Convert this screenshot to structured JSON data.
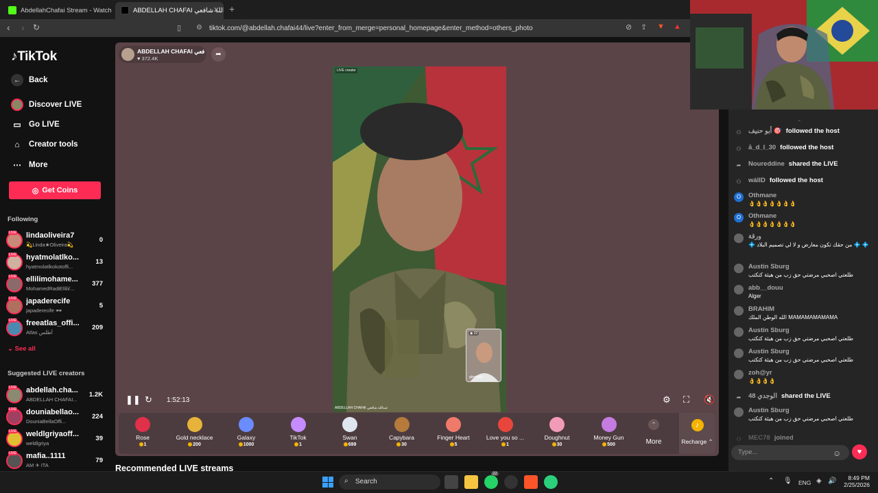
{
  "browser": {
    "tabs": [
      {
        "title": "AbdellahChafai Stream - Watch Live o"
      },
      {
        "title": "ABDELLAH CHAFAI عبدالله شافعي"
      }
    ],
    "url": "tiktok.com/@abdellah.chafai44/live?enter_from_merge=personal_homepage&enter_method=others_photo"
  },
  "sidebar": {
    "logo": "TikTok",
    "nav": [
      {
        "label": "Back",
        "icon": "arrow-left-icon"
      },
      {
        "label": "Discover LIVE",
        "icon": "avatar-icon"
      },
      {
        "label": "Go LIVE",
        "icon": "camera-icon"
      },
      {
        "label": "Creator tools",
        "icon": "home-icon"
      },
      {
        "label": "More",
        "icon": "ellipsis-icon"
      }
    ],
    "get_coins": "Get Coins",
    "following_title": "Following",
    "following": [
      {
        "name": "lindaoliveira7",
        "sub": "💫Linda★Oliveira💫",
        "count": "0"
      },
      {
        "name": "hyatmolatlko...",
        "sub": "hyatmolatlkokotoffi...",
        "count": "13"
      },
      {
        "name": "ellilimohame...",
        "sub": "MohamedRadiEllili/...",
        "count": "377"
      },
      {
        "name": "japaderecife",
        "sub": "japaderecife 🕶",
        "count": "5"
      },
      {
        "name": "freeatlas_offi...",
        "sub": "Atlas أطلس",
        "count": "209"
      }
    ],
    "see_all": "See all",
    "suggested_title": "Suggested LIVE creators",
    "suggested": [
      {
        "name": "abdellah.cha...",
        "sub": "ABDELLAH CHAFAI...",
        "count": "1.2K"
      },
      {
        "name": "douniabellao...",
        "sub": "DouniaBellaOffi...",
        "count": "224"
      },
      {
        "name": "weldlgriyaoff...",
        "sub": "weldlgriya",
        "count": "39"
      },
      {
        "name": "mafia..1111",
        "sub": "AM ✈ ITA",
        "count": "79"
      }
    ]
  },
  "stream": {
    "host_name": "ABDELLAH CHAFAI عبدالله شافعي",
    "likes": "372.4K",
    "creator_badge": "LIVE creator",
    "caption": "ABDELLAH CHAFAI عبدالله شافعي",
    "pip_label": "gbmbaal...",
    "pip_viewers": "22",
    "elapsed": "1:52:13",
    "recommended_title": "Recommended LIVE streams"
  },
  "gifts": [
    {
      "name": "Rose",
      "price": "1",
      "color": "#e0304a"
    },
    {
      "name": "Gold necklace",
      "price": "200",
      "color": "#e8b33a"
    },
    {
      "name": "Galaxy",
      "price": "1000",
      "color": "#6a8cff"
    },
    {
      "name": "TikTok",
      "price": "1",
      "color": "#c58cff"
    },
    {
      "name": "Swan",
      "price": "699",
      "color": "#dfe6f0"
    },
    {
      "name": "Capybara",
      "price": "30",
      "color": "#b57a3c"
    },
    {
      "name": "Finger Heart",
      "price": "5",
      "color": "#f07a6a"
    },
    {
      "name": "Love you so ...",
      "price": "1",
      "color": "#e8463c"
    },
    {
      "name": "Doughnut",
      "price": "30",
      "color": "#f29bb8"
    },
    {
      "name": "Money Gun",
      "price": "500",
      "color": "#c47ce0"
    }
  ],
  "gift_more": "More",
  "recharge": "Recharge",
  "chat": {
    "messages": [
      {
        "user": "أبو حنيف 🎯",
        "action": "followed the host",
        "type": "event"
      },
      {
        "user": "ā_d_l_30",
        "action": "followed the host",
        "type": "event"
      },
      {
        "user": "Noureddine",
        "action": "shared the LIVE",
        "type": "share"
      },
      {
        "user": "wálID",
        "action": "followed the host",
        "type": "event"
      },
      {
        "user": "Othmane",
        "text": "👌👌👌👌👌👌👌",
        "type": "comment",
        "badge": "O"
      },
      {
        "user": "Othmane",
        "text": "👌👌👌👌👌👌👌",
        "type": "comment",
        "badge": "O"
      },
      {
        "user": "ورقة",
        "text": "💠 من حقك تكون معارض و لا لي تصميم البلاد 💠 💠",
        "type": "comment"
      },
      {
        "user": "Austin Sburg",
        "text": "طلعتي اصحبي مرضتي حق زب من هيئة كتكتب",
        "type": "comment"
      },
      {
        "user": "abb__douu",
        "text": "Alger",
        "type": "comment"
      },
      {
        "user": "BRAHIM",
        "text": "الله الوطن الملك MAMAMAMAMAMA",
        "type": "comment"
      },
      {
        "user": "Austin Sburg",
        "text": "طلعتي اصحبي مرضتي حق زب من هيئة كتكتب",
        "type": "comment"
      },
      {
        "user": "Austin Sburg",
        "text": "طلعتي اصحبي مرضتي حق زب من هيئة كتكتب",
        "type": "comment"
      },
      {
        "user": "zoh@yr",
        "text": "👌👌👌👌",
        "type": "comment"
      },
      {
        "user": "48 الوجدي",
        "action": "shared the LIVE",
        "type": "share"
      },
      {
        "user": "Austin Sburg",
        "text": "طلعتي اصحبي مرضتي حق زب من هيئة كتكتب",
        "type": "comment"
      },
      {
        "user": "MEC78",
        "action": "joined",
        "type": "event"
      }
    ],
    "input_placeholder": "Type..."
  },
  "taskbar": {
    "search": "Search",
    "lang": "ENG",
    "time": "8:49 PM",
    "date": "2/25/2026",
    "whatsapp_badge": "22"
  },
  "colors": {
    "accent": "#fe2c55",
    "player_bg": "#5b4448"
  }
}
